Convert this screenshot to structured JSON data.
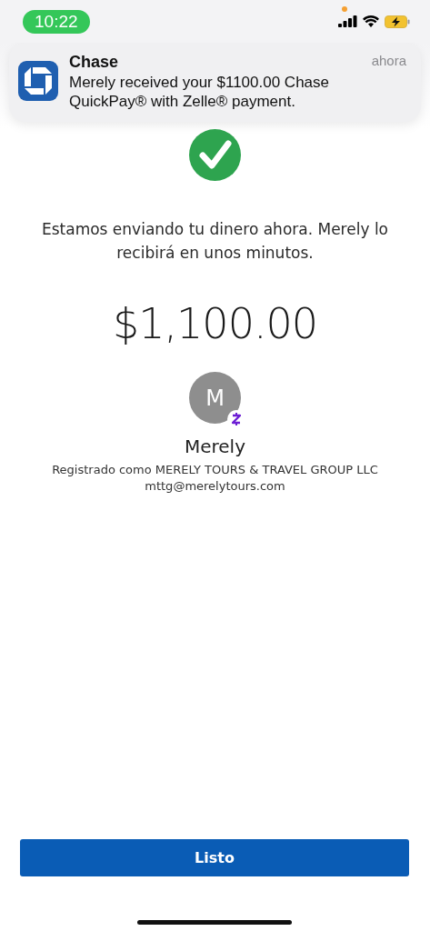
{
  "status_bar": {
    "time": "10:22"
  },
  "notification": {
    "app": "Chase",
    "message": "Merely received your $1100.00 Chase QuickPay® with Zelle® payment.",
    "time": "ahora"
  },
  "confirmation": {
    "message": "Estamos enviando tu dinero ahora. Merely lo recibirá en unos minutos.",
    "amount": "$1,100.00"
  },
  "recipient": {
    "initial": "M",
    "name": "Merely",
    "registered": "Registrado como MERELY TOURS & TRAVEL GROUP LLC",
    "email": "mttg@merelytours.com"
  },
  "primary_button": {
    "label": "Listo"
  }
}
